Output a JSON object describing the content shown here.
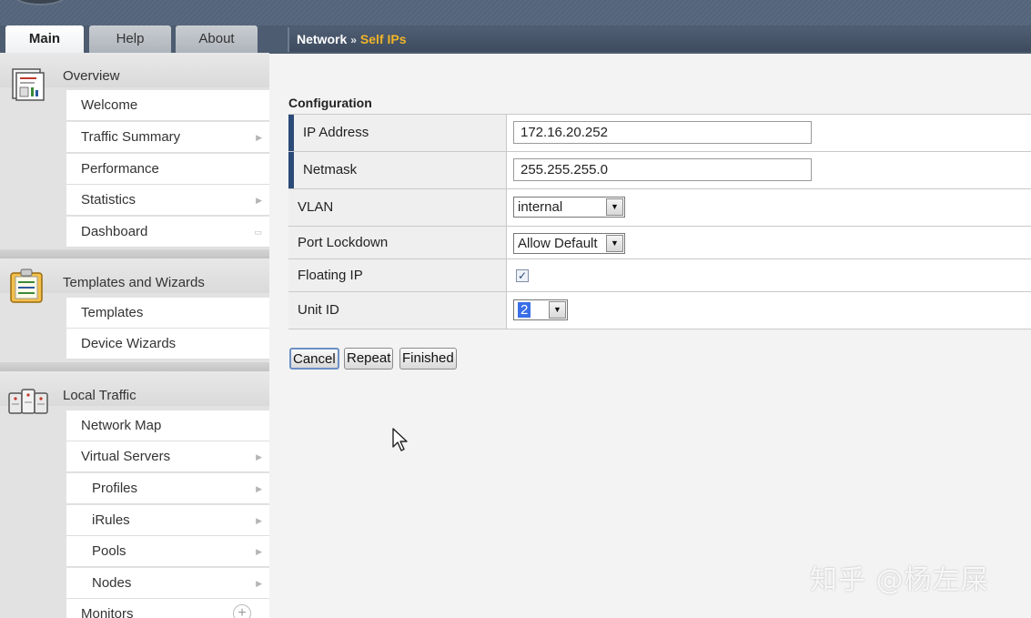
{
  "tabs": [
    {
      "label": "Main"
    },
    {
      "label": "Help"
    },
    {
      "label": "About"
    }
  ],
  "breadcrumb": {
    "parent": "Network",
    "separator": "»",
    "current": "Self IPs"
  },
  "sidebar": {
    "overview": {
      "title": "Overview",
      "items": [
        {
          "label": "Welcome"
        },
        {
          "label": "Traffic Summary"
        },
        {
          "label": "Performance"
        },
        {
          "label": "Statistics"
        },
        {
          "label": "Dashboard"
        }
      ]
    },
    "templates": {
      "title": "Templates and Wizards",
      "items": [
        {
          "label": "Templates"
        },
        {
          "label": "Device Wizards"
        }
      ]
    },
    "local_traffic": {
      "title": "Local Traffic",
      "items": [
        {
          "label": "Network Map"
        },
        {
          "label": "Virtual Servers"
        },
        {
          "label": "Profiles"
        },
        {
          "label": "iRules"
        },
        {
          "label": "Pools"
        },
        {
          "label": "Nodes"
        },
        {
          "label": "Monitors"
        }
      ]
    }
  },
  "config": {
    "title": "Configuration",
    "ip_address": {
      "label": "IP Address",
      "value": "172.16.20.252"
    },
    "netmask": {
      "label": "Netmask",
      "value": "255.255.255.0"
    },
    "vlan": {
      "label": "VLAN",
      "value": "internal"
    },
    "port_lockdown": {
      "label": "Port Lockdown",
      "value": "Allow Default"
    },
    "floating_ip": {
      "label": "Floating IP",
      "checked": true,
      "mark": "✓"
    },
    "unit_id": {
      "label": "Unit ID",
      "value": "2"
    }
  },
  "buttons": {
    "cancel": "Cancel",
    "repeat": "Repeat",
    "finished": "Finished"
  },
  "watermark": "知乎 @杨左屎",
  "colors": {
    "accent_current": "#f0b428",
    "header_bg": "#4d5c70",
    "required_marker": "#2b4a78"
  }
}
